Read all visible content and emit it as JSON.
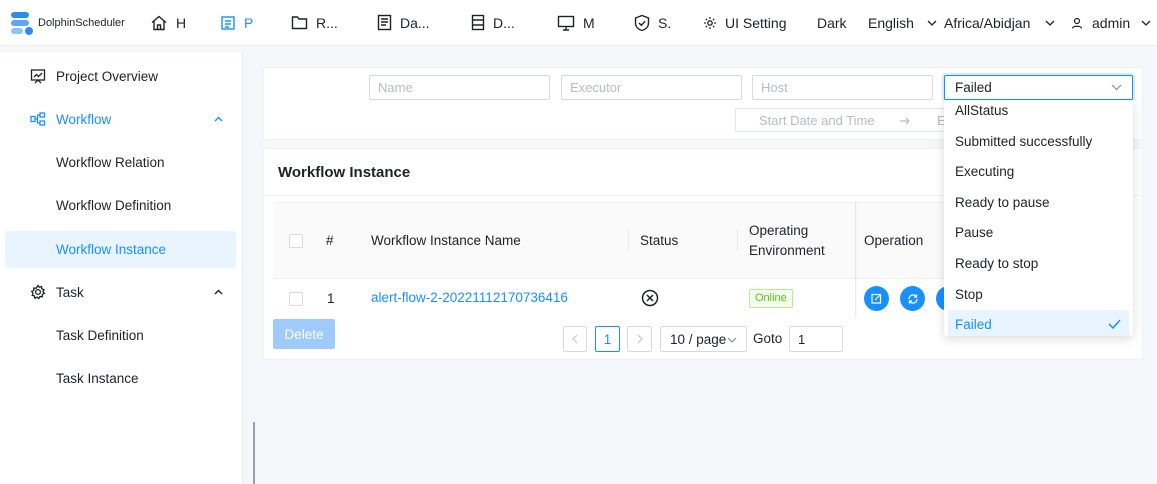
{
  "header": {
    "logo_text": "DolphinScheduler",
    "nav": [
      {
        "label": "H",
        "icon": "home-icon"
      },
      {
        "label": "P",
        "icon": "project-icon",
        "active": true
      },
      {
        "label": "R...",
        "icon": "folder-icon"
      },
      {
        "label": "Da...",
        "icon": "data-quality-icon"
      },
      {
        "label": "D...",
        "icon": "datasource-icon"
      },
      {
        "label": "M",
        "icon": "monitor-icon"
      },
      {
        "label": "S.",
        "icon": "security-icon"
      }
    ],
    "ui_setting": "UI Setting",
    "theme": "Dark",
    "language": "English",
    "timezone": "Africa/Abidjan",
    "user": "admin"
  },
  "sidebar": {
    "project_overview": "Project Overview",
    "workflow": "Workflow",
    "workflow_relation": "Workflow Relation",
    "workflow_definition": "Workflow Definition",
    "workflow_instance": "Workflow Instance",
    "task": "Task",
    "task_definition": "Task Definition",
    "task_instance": "Task Instance"
  },
  "filters": {
    "name_placeholder": "Name",
    "executor_placeholder": "Executor",
    "host_placeholder": "Host",
    "status_selected": "Failed",
    "start_placeholder": "Start Date and Time",
    "end_placeholder": "E"
  },
  "status_options": [
    "AllStatus",
    "Submitted successfully",
    "Executing",
    "Ready to pause",
    "Pause",
    "Ready to stop",
    "Stop",
    "Failed"
  ],
  "table": {
    "title": "Workflow Instance",
    "headers": {
      "index": "#",
      "name": "Workflow Instance Name",
      "status": "Status",
      "env_line1": "Operating",
      "env_line2": "Environment",
      "operation": "Operation"
    },
    "rows": [
      {
        "index": "1",
        "name": "alert-flow-2-20221112170736416",
        "status_icon": "failed-circle-x-icon",
        "environment": "Online"
      }
    ]
  },
  "footer": {
    "delete_label": "Delete",
    "current_page": "1",
    "page_size": "10 / page",
    "goto_label": "Goto",
    "goto_value": "1"
  },
  "colors": {
    "primary": "#1890ff",
    "success": "#52c41a",
    "disabled_primary": "#9ecbfb"
  }
}
